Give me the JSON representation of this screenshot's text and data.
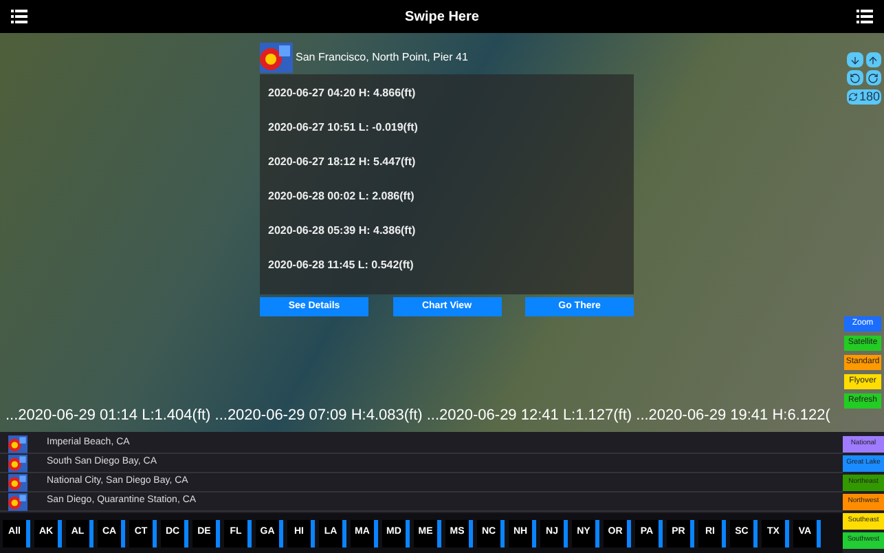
{
  "header": {
    "title": "Swipe Here"
  },
  "popup": {
    "station": "San Francisco, North Point, Pier 41",
    "tides": [
      "2020-06-27 04:20 H: 4.866(ft)",
      "2020-06-27 10:51 L: -0.019(ft)",
      "2020-06-27 18:12 H: 5.447(ft)",
      "2020-06-28 00:02 L: 2.086(ft)",
      "2020-06-28 05:39 H: 4.386(ft)",
      "2020-06-28 11:45 L: 0.542(ft)"
    ],
    "buttons": [
      "See Details",
      "Chart View",
      "Go There"
    ]
  },
  "map_controls": {
    "rotate_label": "180",
    "modes": [
      {
        "label": "Zoom",
        "color": "#1a6dff"
      },
      {
        "label": "Satellite",
        "color": "#22cc22"
      },
      {
        "label": "Standard",
        "color": "#ff9900"
      },
      {
        "label": "Flyover",
        "color": "#ffdd00"
      },
      {
        "label": "Refresh",
        "color": "#22cc22"
      }
    ]
  },
  "ticker": "...2020-06-29 01:14 L:1.404(ft) ...2020-06-29 07:09 H:4.083(ft) ...2020-06-29 12:41 L:1.127(ft) ...2020-06-29 19:41 H:6.122(",
  "stations": [
    "Imperial Beach, CA",
    "South San Diego Bay, CA",
    "National City, San Diego Bay, CA",
    "San Diego, Quarantine Station, CA"
  ],
  "regions": [
    {
      "label": "National",
      "color": "#9f7cff"
    },
    {
      "label": "Great Lake",
      "color": "#1a8cff"
    },
    {
      "label": "Northeast",
      "color": "#339900"
    },
    {
      "label": "Northwest",
      "color": "#ff8c00"
    },
    {
      "label": "Southeast",
      "color": "#ffdd00"
    },
    {
      "label": "Southwest",
      "color": "#22cc33"
    }
  ],
  "states": [
    "All",
    "AK",
    "AL",
    "CA",
    "CT",
    "DC",
    "DE",
    "FL",
    "GA",
    "HI",
    "LA",
    "MA",
    "MD",
    "ME",
    "MS",
    "NC",
    "NH",
    "NJ",
    "NY",
    "OR",
    "PA",
    "PR",
    "RI",
    "SC",
    "TX",
    "VA"
  ]
}
